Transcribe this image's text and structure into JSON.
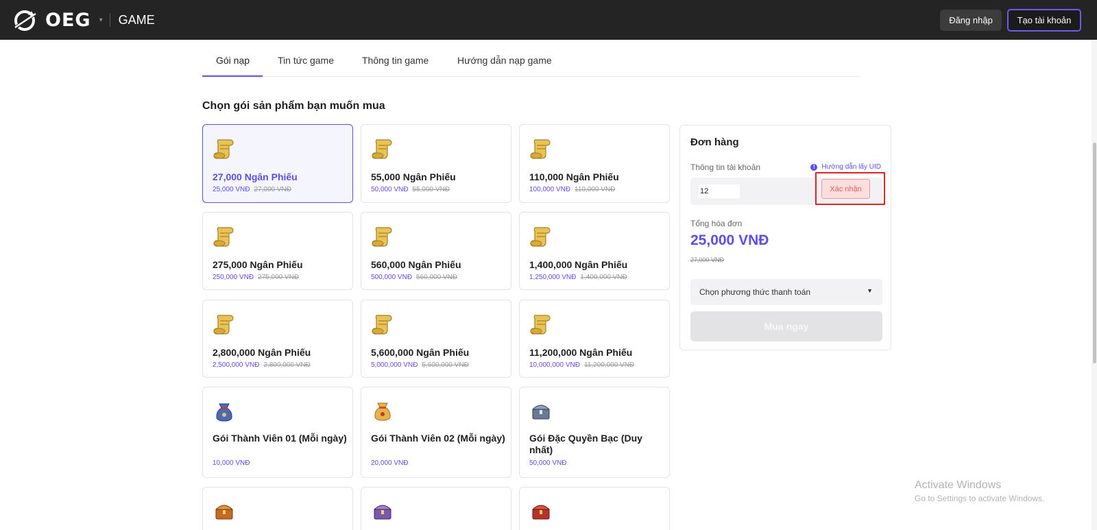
{
  "header": {
    "brand": "OEG",
    "caret": "▾",
    "section": "GAME",
    "login_label": "Đăng nhập",
    "register_label": "Tạo tài khoản"
  },
  "tabs": [
    {
      "label": "Gói nạp",
      "active": true
    },
    {
      "label": "Tin tức game",
      "active": false
    },
    {
      "label": "Thông tin game",
      "active": false
    },
    {
      "label": "Hướng dẫn nạp game",
      "active": false
    }
  ],
  "section_title": "Chọn gói sản phẩm bạn muốn mua",
  "products": [
    {
      "name": "27,000 Ngân Phiếu",
      "price": "25,000 VNĐ",
      "old_price": "27,000 VNĐ",
      "icon": "scroll-icon",
      "selected": true
    },
    {
      "name": "55,000 Ngân Phiếu",
      "price": "50,000 VNĐ",
      "old_price": "55,000 VNĐ",
      "icon": "scroll-icon"
    },
    {
      "name": "110,000 Ngân Phiếu",
      "price": "100,000 VNĐ",
      "old_price": "110,000 VNĐ",
      "icon": "scroll-icon"
    },
    {
      "name": "275,000 Ngân Phiếu",
      "price": "250,000 VNĐ",
      "old_price": "275,000 VNĐ",
      "icon": "scroll-icon"
    },
    {
      "name": "560,000 Ngân Phiếu",
      "price": "500,000 VNĐ",
      "old_price": "560,000 VNĐ",
      "icon": "scroll-icon"
    },
    {
      "name": "1,400,000 Ngân Phiếu",
      "price": "1,250,000 VNĐ",
      "old_price": "1,400,000 VNĐ",
      "icon": "scroll-icon"
    },
    {
      "name": "2,800,000 Ngân Phiếu",
      "price": "2,500,000 VNĐ",
      "old_price": "2,800,000 VNĐ",
      "icon": "scroll-icon"
    },
    {
      "name": "5,600,000 Ngân Phiếu",
      "price": "5,000,000 VNĐ",
      "old_price": "5,600,000 VNĐ",
      "icon": "scroll-icon"
    },
    {
      "name": "11,200,000 Ngân Phiếu",
      "price": "10,000,000 VNĐ",
      "old_price": "11,200,000 VNĐ",
      "icon": "scroll-icon"
    },
    {
      "name": "Gói Thành Viên 01 (Mỗi ngày)",
      "price": "10,000 VNĐ",
      "old_price": "",
      "icon": "blue-pouch-icon"
    },
    {
      "name": "Gói Thành Viên 02 (Mỗi ngày)",
      "price": "20,000 VNĐ",
      "old_price": "",
      "icon": "gold-pouch-icon"
    },
    {
      "name": "Gói Đặc Quyền Bạc (Duy nhất)",
      "price": "50,000 VNĐ",
      "old_price": "",
      "icon": "silver-chest-icon"
    },
    {
      "name": "",
      "price": "",
      "old_price": "",
      "icon": "gold-chest-icon"
    },
    {
      "name": "",
      "price": "",
      "old_price": "",
      "icon": "purple-chest-icon"
    },
    {
      "name": "",
      "price": "",
      "old_price": "",
      "icon": "red-chest-icon"
    }
  ],
  "order": {
    "title": "Đơn hàng",
    "account_label": "Thông tin tài khoản",
    "uid_help": "Hướng dẫn lấy UID",
    "uid_value": "12",
    "confirm_label": "Xác nhận",
    "total_label": "Tổng hóa đơn",
    "total": "25,000 VNĐ",
    "total_old": "27,000 VNĐ",
    "payment_placeholder": "Chọn phương thức thanh toán",
    "buy_label": "Mua ngay"
  },
  "watermark": {
    "title": "Activate Windows",
    "subtitle": "Go to Settings to activate Windows."
  },
  "colors": {
    "accent": "#5b4ef0",
    "header_bg": "#242424",
    "highlight": "#e02424"
  }
}
